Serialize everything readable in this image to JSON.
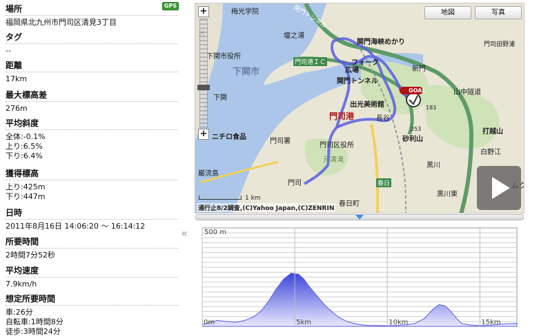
{
  "info": {
    "gps_badge": "GPS",
    "fields": [
      {
        "label": "場所",
        "lines": [
          "福岡県北九州市門司区清見3丁目"
        ]
      },
      {
        "label": "タグ",
        "lines": [
          "--"
        ]
      },
      {
        "label": "距離",
        "lines": [
          "17km"
        ]
      },
      {
        "label": "最大標高差",
        "lines": [
          "276m"
        ]
      },
      {
        "label": "平均斜度",
        "lines": [
          "全体:-0.1%",
          "上り:6.5%",
          "下り:6.4%"
        ]
      },
      {
        "label": "獲得標高",
        "lines": [
          "上り:425m",
          "下り:447m"
        ]
      },
      {
        "label": "日時",
        "lines": [
          "2011年8月16日 14:06:20 〜 16:14:12"
        ]
      },
      {
        "label": "所要時間",
        "lines": [
          "2時間7分52秒"
        ]
      },
      {
        "label": "平均速度",
        "lines": [
          "7.9km/h"
        ]
      },
      {
        "label": "想定所要時間",
        "lines": [
          "車:26分",
          "自転車:1時間8分",
          "徒歩:3時間24分"
        ]
      }
    ]
  },
  "collapse_glyph": "«",
  "map": {
    "buttons": {
      "map": "地図",
      "photo": "写真"
    },
    "zoom_in": "+",
    "zoom_out": "+",
    "scale_label": "1 km",
    "copyright": "通行止8/2調査,(C)Yahoo Japan,(C)ZENRIN",
    "goal_label": "GOAL",
    "labels": [
      "梅光学院",
      "大",
      "壇之浦",
      "関門海峡めかり",
      "下関市役所",
      "門司港ＩＣ",
      "フォーク",
      "下関市",
      "新門",
      "広場",
      "関門トンネル",
      "山中隧道",
      "下関",
      "出光美術館",
      "183",
      "門司港",
      "長谷",
      "253",
      "打越山",
      "ニチロ食品",
      "門司署",
      "門司区役所",
      "砂利山",
      "白野江",
      "元清滝",
      "黒川",
      "巌流島",
      "門司",
      "黒川東",
      "春日",
      "春日町",
      "門司田野浦",
      "ムク",
      "関門トンネル"
    ],
    "route_color": "#5a5ee0",
    "accent": "#b31212"
  },
  "chart_data": {
    "type": "area",
    "title": "",
    "xlabel": "",
    "ylabel": "",
    "x_unit": "km",
    "y_unit": "m",
    "xlim": [
      0,
      17
    ],
    "ylim": [
      0,
      500
    ],
    "x_ticks": [
      {
        "value": 0,
        "label": "0m"
      },
      {
        "value": 5,
        "label": "5km"
      },
      {
        "value": 10,
        "label": "10km"
      },
      {
        "value": 15,
        "label": "15km"
      }
    ],
    "y_ticks": [
      {
        "value": 500,
        "label": "500 m"
      }
    ],
    "grid": true,
    "series": [
      {
        "x": [
          0,
          0.3,
          0.8,
          1.3,
          1.8,
          2.3,
          2.8,
          3.2,
          3.6,
          4.0,
          4.4,
          4.8,
          5.2,
          5.5,
          5.8,
          6.2,
          6.6,
          7.0,
          7.4,
          7.8,
          8.2,
          8.6,
          9.0,
          9.5,
          10.0,
          10.5,
          11.0,
          11.5,
          12.0,
          12.5,
          12.8,
          13.1,
          13.4,
          13.7,
          14.0,
          14.4,
          14.8,
          15.2,
          15.6,
          16.0,
          16.5,
          17.0
        ],
        "y": [
          10,
          15,
          30,
          25,
          20,
          30,
          50,
          80,
          130,
          190,
          240,
          270,
          265,
          240,
          200,
          155,
          110,
          75,
          45,
          25,
          15,
          8,
          5,
          4,
          3,
          5,
          8,
          15,
          40,
          90,
          110,
          105,
          80,
          45,
          15,
          8,
          5,
          4,
          6,
          10,
          14,
          15
        ]
      }
    ],
    "fill_top": "#3c46d8",
    "fill_bottom": "#e8e8ff",
    "line_color": "#5a5ee0"
  }
}
